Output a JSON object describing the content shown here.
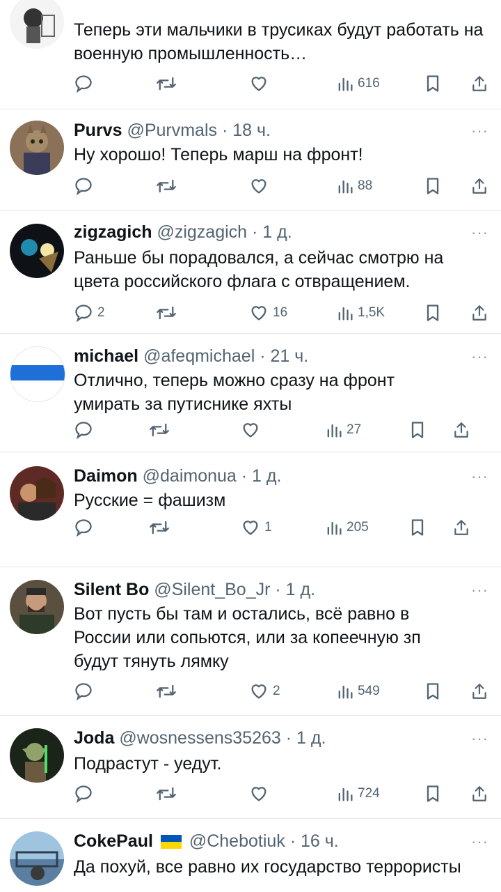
{
  "tweets": [
    {
      "name": "",
      "handle": "",
      "time": "",
      "text": "Теперь эти мальчики в трусиках будут работать на военную промышленность…",
      "replies": "",
      "likes": "",
      "views": "616"
    },
    {
      "name": "Purvs",
      "handle": "@Purvmals",
      "time": "· 18 ч.",
      "text": "Ну хорошо! Теперь марш на фронт!",
      "replies": "",
      "likes": "",
      "views": "88"
    },
    {
      "name": "zigzagich",
      "handle": "@zigzagich",
      "time": "· 1 д.",
      "text": "Раньше бы порадовался, а сейчас смотрю на цвета российского флага с отвращением.",
      "replies": "2",
      "likes": "16",
      "views": "1,5K"
    },
    {
      "name": "michael",
      "handle": "@afeqmichael",
      "time": "· 21 ч.",
      "text": "Отлично, теперь можно сразу на фронт умирать за путиснике яхты",
      "replies": "",
      "likes": "",
      "views": "27"
    },
    {
      "name": "Daimon",
      "handle": "@daimonua",
      "time": "· 1 д.",
      "text": "Русские = фашизм",
      "replies": "",
      "likes": "1",
      "views": "205"
    },
    {
      "name": "Silent Bo",
      "handle": "@Silent_Bo_Jr",
      "time": "· 1 д.",
      "text": "Вот пусть бы там и остались, всё равно в России или сопьются, или за копеечную зп будут тянуть лямку",
      "replies": "",
      "likes": "2",
      "views": "549"
    },
    {
      "name": "Joda",
      "handle": "@wosnessens35263",
      "time": "· 1 д.",
      "text": "Подрастут - уедут.",
      "replies": "",
      "likes": "",
      "views": "724"
    },
    {
      "name": "CokePaul",
      "handle": "@Chebotiuk",
      "time": "· 16 ч.",
      "text": "Да похуй, все равно их государство террористы",
      "replies": "",
      "likes": "",
      "views": ""
    }
  ],
  "more_label": "···",
  "icons": {
    "reply": "reply-icon",
    "retweet": "retweet-icon",
    "like": "like-icon",
    "views": "views-icon",
    "bookmark": "bookmark-icon",
    "share": "share-icon"
  },
  "colors": {
    "text": "#0f1419",
    "muted": "#536471",
    "divider": "#e6e6e6",
    "flag_blue": "#0057b7",
    "flag_yellow": "#ffd700"
  }
}
